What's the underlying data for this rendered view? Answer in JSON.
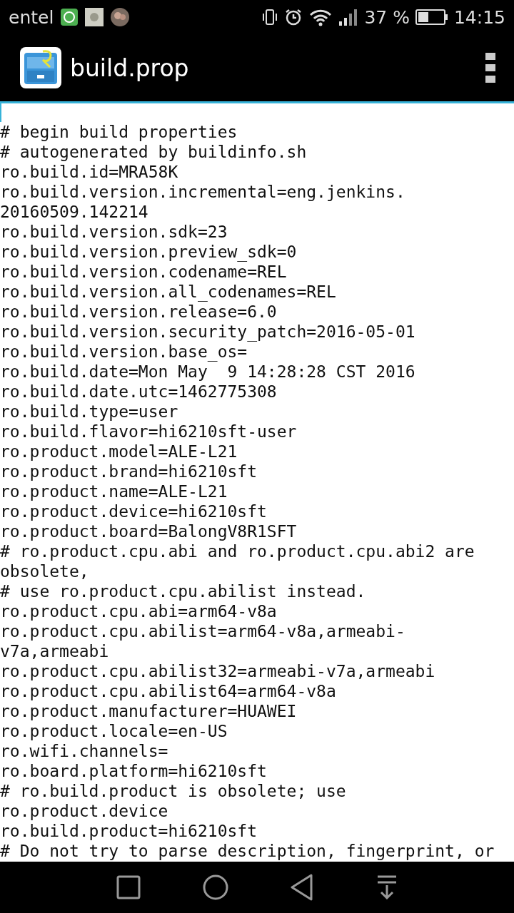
{
  "status_bar": {
    "carrier": "entel",
    "battery_text": "37 %",
    "time": "14:15"
  },
  "app_bar": {
    "title": "build.prop"
  },
  "editor": {
    "lines": [
      "# begin build properties",
      "# autogenerated by buildinfo.sh",
      "ro.build.id=MRA58K",
      "ro.build.version.incremental=eng.jenkins.",
      "20160509.142214",
      "ro.build.version.sdk=23",
      "ro.build.version.preview_sdk=0",
      "ro.build.version.codename=REL",
      "ro.build.version.all_codenames=REL",
      "ro.build.version.release=6.0",
      "ro.build.version.security_patch=2016-05-01",
      "ro.build.version.base_os=",
      "ro.build.date=Mon May  9 14:28:28 CST 2016",
      "ro.build.date.utc=1462775308",
      "ro.build.type=user",
      "ro.build.flavor=hi6210sft-user",
      "ro.product.model=ALE-L21",
      "ro.product.brand=hi6210sft",
      "ro.product.name=ALE-L21",
      "ro.product.device=hi6210sft",
      "ro.product.board=BalongV8R1SFT",
      "# ro.product.cpu.abi and ro.product.cpu.abi2 are",
      "obsolete,",
      "# use ro.product.cpu.abilist instead.",
      "ro.product.cpu.abi=arm64-v8a",
      "ro.product.cpu.abilist=arm64-v8a,armeabi-",
      "v7a,armeabi",
      "ro.product.cpu.abilist32=armeabi-v7a,armeabi",
      "ro.product.cpu.abilist64=arm64-v8a",
      "ro.product.manufacturer=HUAWEI",
      "ro.product.locale=en-US",
      "ro.wifi.channels=",
      "ro.board.platform=hi6210sft",
      "# ro.build.product is obsolete; use",
      "ro.product.device",
      "ro.build.product=hi6210sft",
      "# Do not try to parse description, fingerprint, or"
    ]
  }
}
